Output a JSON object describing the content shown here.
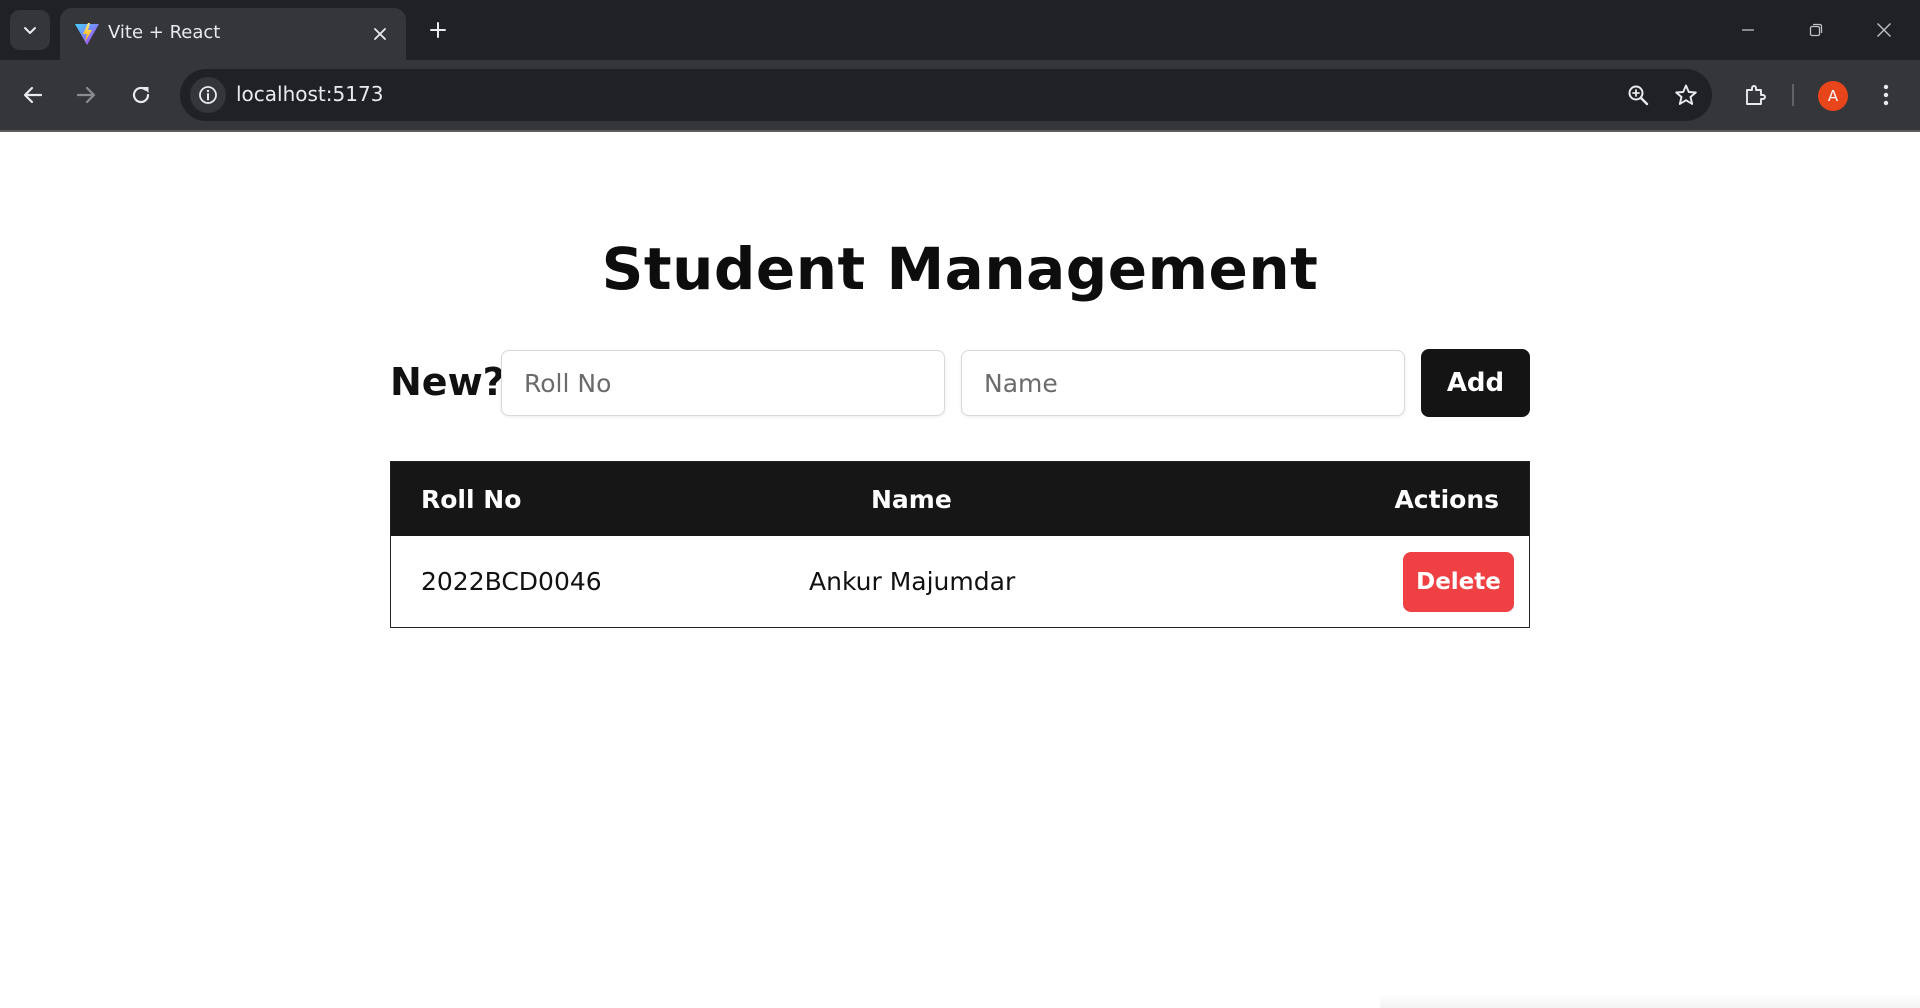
{
  "browser": {
    "tab": {
      "title": "Vite + React",
      "favicon": "vite-logo-icon"
    },
    "url": "localhost:5173",
    "profile_initial": "A",
    "profile_color": "#e8451b",
    "icons": {
      "tab_search": "chevron-down-icon",
      "tab_close": "close-icon",
      "new_tab": "plus-icon",
      "minimize": "minimize-icon",
      "restore": "restore-icon",
      "close_window": "close-icon",
      "back": "arrow-left-icon",
      "forward": "arrow-right-icon",
      "reload": "reload-icon",
      "site_info": "info-icon",
      "zoom": "zoom-in-icon",
      "bookmark": "star-icon",
      "extensions": "puzzle-icon",
      "menu": "kebab-menu-icon"
    }
  },
  "page": {
    "title": "Student Management",
    "form": {
      "label": "New?",
      "roll_placeholder": "Roll No",
      "roll_value": "",
      "name_placeholder": "Name",
      "name_value": "",
      "add_label": "Add"
    },
    "table": {
      "headers": {
        "roll": "Roll No",
        "name": "Name",
        "actions": "Actions"
      },
      "rows": [
        {
          "roll": "2022BCD0046",
          "name": "Ankur Majumdar",
          "action_label": "Delete"
        }
      ]
    },
    "colors": {
      "header_bg": "#161616",
      "add_button": "#141414",
      "delete_button": "#ef4144"
    }
  }
}
